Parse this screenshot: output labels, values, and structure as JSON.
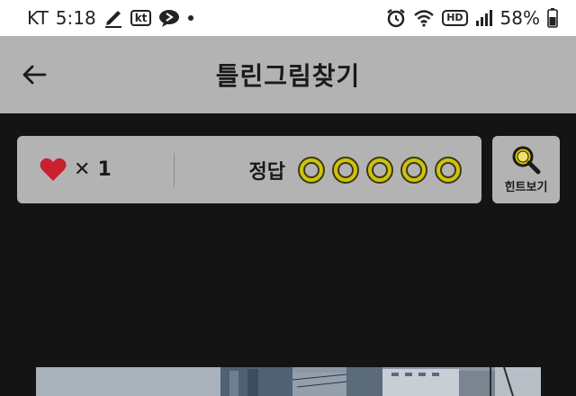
{
  "status_bar": {
    "carrier": "KT",
    "time": "5:18",
    "kt_badge": "kt",
    "hd_badge": "HD",
    "battery": "58%",
    "icons": [
      "pen-icon",
      "kt-icon",
      "chat-bubble-icon",
      "dot-icon",
      "alarm-icon",
      "wifi-icon",
      "hd-icon",
      "signal-icon",
      "battery-icon"
    ]
  },
  "header": {
    "title": "틀린그림찾기",
    "back_icon": "arrow-left-icon"
  },
  "game_info": {
    "lives_multiplier": "✕",
    "lives_count": "1",
    "answers_label": "정답",
    "answers_found": 0,
    "answers_total": 5
  },
  "hint": {
    "label": "힌트보기",
    "icon": "magnifier-icon"
  },
  "colors": {
    "background": "#141414",
    "panel": "#b3b3b3",
    "heart": "#c8202e",
    "slot_ring": "#cfc20e",
    "magnifier": "#d9c500"
  }
}
